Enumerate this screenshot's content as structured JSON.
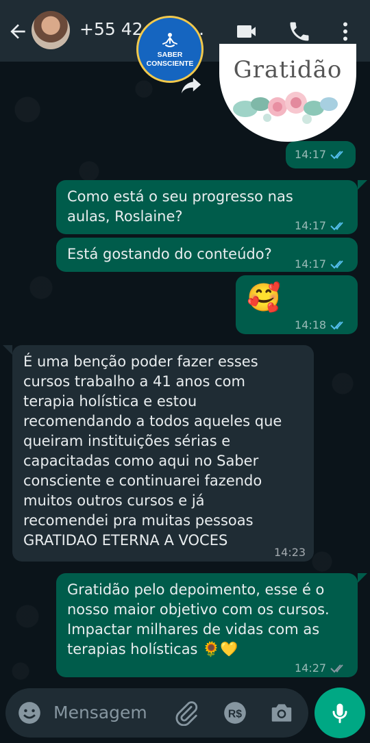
{
  "header": {
    "contact_name": "+55 42 9…1…",
    "badge_line1": "SABER",
    "badge_line2": "CONSCIENTE"
  },
  "media": {
    "caption": "Gratidão",
    "time": "14:17"
  },
  "messages": [
    {
      "text": "Como está o seu progresso nas aulas, Roslaine?",
      "time": "14:17"
    },
    {
      "text": "Está gostando do conteúdo?",
      "time": "14:17"
    },
    {
      "text": "🥰",
      "time": "14:18"
    },
    {
      "text": "É  uma benção  poder fazer esses cursos trabalho a 41 anos com terapia holística e estou recomendando a todos aqueles que queiram instituições  sérias e capacitadas como aqui no Saber consciente e continuarei fazendo muitos outros cursos e já recomendei pra muitas pessoas GRATIDAO ETERNA A VOCES",
      "time": "14:23"
    },
    {
      "text": "Gratidão pelo depoimento, esse é o nosso maior objetivo com os cursos. Impactar milhares de vidas com as terapias holísticas 🌻💛",
      "time": "14:27"
    }
  ],
  "input": {
    "placeholder": "Mensagem"
  },
  "colors": {
    "outgoing_bubble": "#005c4b",
    "incoming_bubble": "#1f2c34",
    "header": "#1f2c34",
    "background": "#0b141a",
    "accent": "#00a884",
    "read_tick": "#53bdeb"
  },
  "icons": [
    "back-arrow-icon",
    "video-call-icon",
    "phone-icon",
    "more-options-icon",
    "forward-icon",
    "emoji-icon",
    "attach-icon",
    "payment-icon",
    "camera-icon",
    "mic-icon"
  ]
}
